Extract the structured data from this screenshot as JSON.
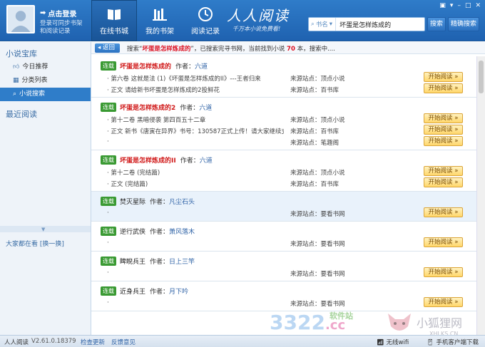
{
  "header": {
    "login_title": "点击登录",
    "login_sub": "登录可同步书架和阅读记录",
    "tabs": [
      {
        "label": "在线书城",
        "icon": "book-icon"
      },
      {
        "label": "我的书架",
        "icon": "bookshelf-icon"
      },
      {
        "label": "阅读记录",
        "icon": "clock-icon"
      }
    ],
    "brand": "人人阅读",
    "brand_sub": "千万本小说免费看!",
    "search_type": "书名",
    "search_value": "坏蛋是怎样炼成的",
    "search_btn": "搜索",
    "precise_btn": "精确搜索"
  },
  "sidebar": {
    "section1": "小说宝库",
    "items": [
      {
        "label": "今日推荐",
        "icon": "thumb-up-icon"
      },
      {
        "label": "分类列表",
        "icon": "grid-icon"
      },
      {
        "label": "小说搜索",
        "icon": "search-icon"
      }
    ],
    "section2": "最近阅读",
    "watching": "大家都在看 [换一换]"
  },
  "main": {
    "back": "返回",
    "info_pre": "搜索“",
    "info_query": "坏蛋是怎样炼成的",
    "info_mid": "”，已搜索完寻书网，当前找到小说",
    "info_count": "70",
    "info_post": "本，搜索中....",
    "read_label": "开始阅读 »",
    "author_label": "作者：",
    "books": [
      {
        "tag": "连载",
        "title": "坏蛋是怎样炼成的",
        "suffix": "",
        "red": true,
        "author": "六道",
        "rows": [
          {
            "content": "· 第六卷 这就是法 (1)《坏蛋是怎样炼成的II》---王者归来",
            "source": "来源站点：顶点小说"
          },
          {
            "content": "· 正文 请给新书坏蛋是怎样炼成的2投鲜花",
            "source": "来源站点：百书库"
          }
        ]
      },
      {
        "tag": "连载",
        "title": "坏蛋是怎样炼成的",
        "suffix": "2",
        "red": true,
        "author": "六道",
        "rows": [
          {
            "content": "· 第十二卷 黑暗侵袭 第四百五十二章",
            "source": "来源站点：顶点小说"
          },
          {
            "content": "· 正文 新书《唐寅在异界》书号：130587正式上传！请大家继续支持",
            "source": "来源站点：百书库"
          },
          {
            "content": "·",
            "source": "来源站点：笔趣阁"
          }
        ]
      },
      {
        "tag": "连载",
        "title": "坏蛋是怎样炼成的",
        "suffix": "II",
        "red": true,
        "author": "六道",
        "rows": [
          {
            "content": "· 第十二卷 (完结篇)",
            "source": "来源站点：顶点小说"
          },
          {
            "content": "· 正文 (完结篇)",
            "source": "来源站点：百书库"
          }
        ]
      },
      {
        "tag": "连载",
        "title": "焚灭星际",
        "suffix": "",
        "red": false,
        "author": "凡尘石头",
        "highlight": true,
        "rows": [
          {
            "content": "·",
            "source": "来源站点：要看书网"
          }
        ]
      },
      {
        "tag": "连载",
        "title": "逆行武侠",
        "suffix": "",
        "red": false,
        "author": "萧风落木",
        "rows": [
          {
            "content": "·",
            "source": "来源站点：要看书网"
          }
        ]
      },
      {
        "tag": "连载",
        "title": "睥睨兵王",
        "suffix": "",
        "red": false,
        "author": "日上三竿",
        "rows": [
          {
            "content": "·",
            "source": "来源站点：要看书网"
          }
        ]
      },
      {
        "tag": "连载",
        "title": "近身兵王",
        "suffix": "",
        "red": false,
        "author": "月下吟",
        "rows": [
          {
            "content": "·",
            "source": "来源站点：要看书网"
          }
        ]
      }
    ]
  },
  "statusbar": {
    "app": "人人阅读",
    "version": "V2.61.0.18379",
    "update": "检查更新",
    "feedback": "反馈意见",
    "right1": "无线wifi",
    "right2": "手机客户端下载"
  },
  "watermarks": {
    "w1": "3322",
    "w1b": ".cc",
    "w1sub": "软件站",
    "w2": "小狐狸网",
    "w2sub": "XHLKS.CN"
  },
  "colors": {
    "accent": "#2f7cc9",
    "title_red": "#d01818",
    "tag_green": "#3a9a33",
    "read_btn": "#ffd76a"
  }
}
